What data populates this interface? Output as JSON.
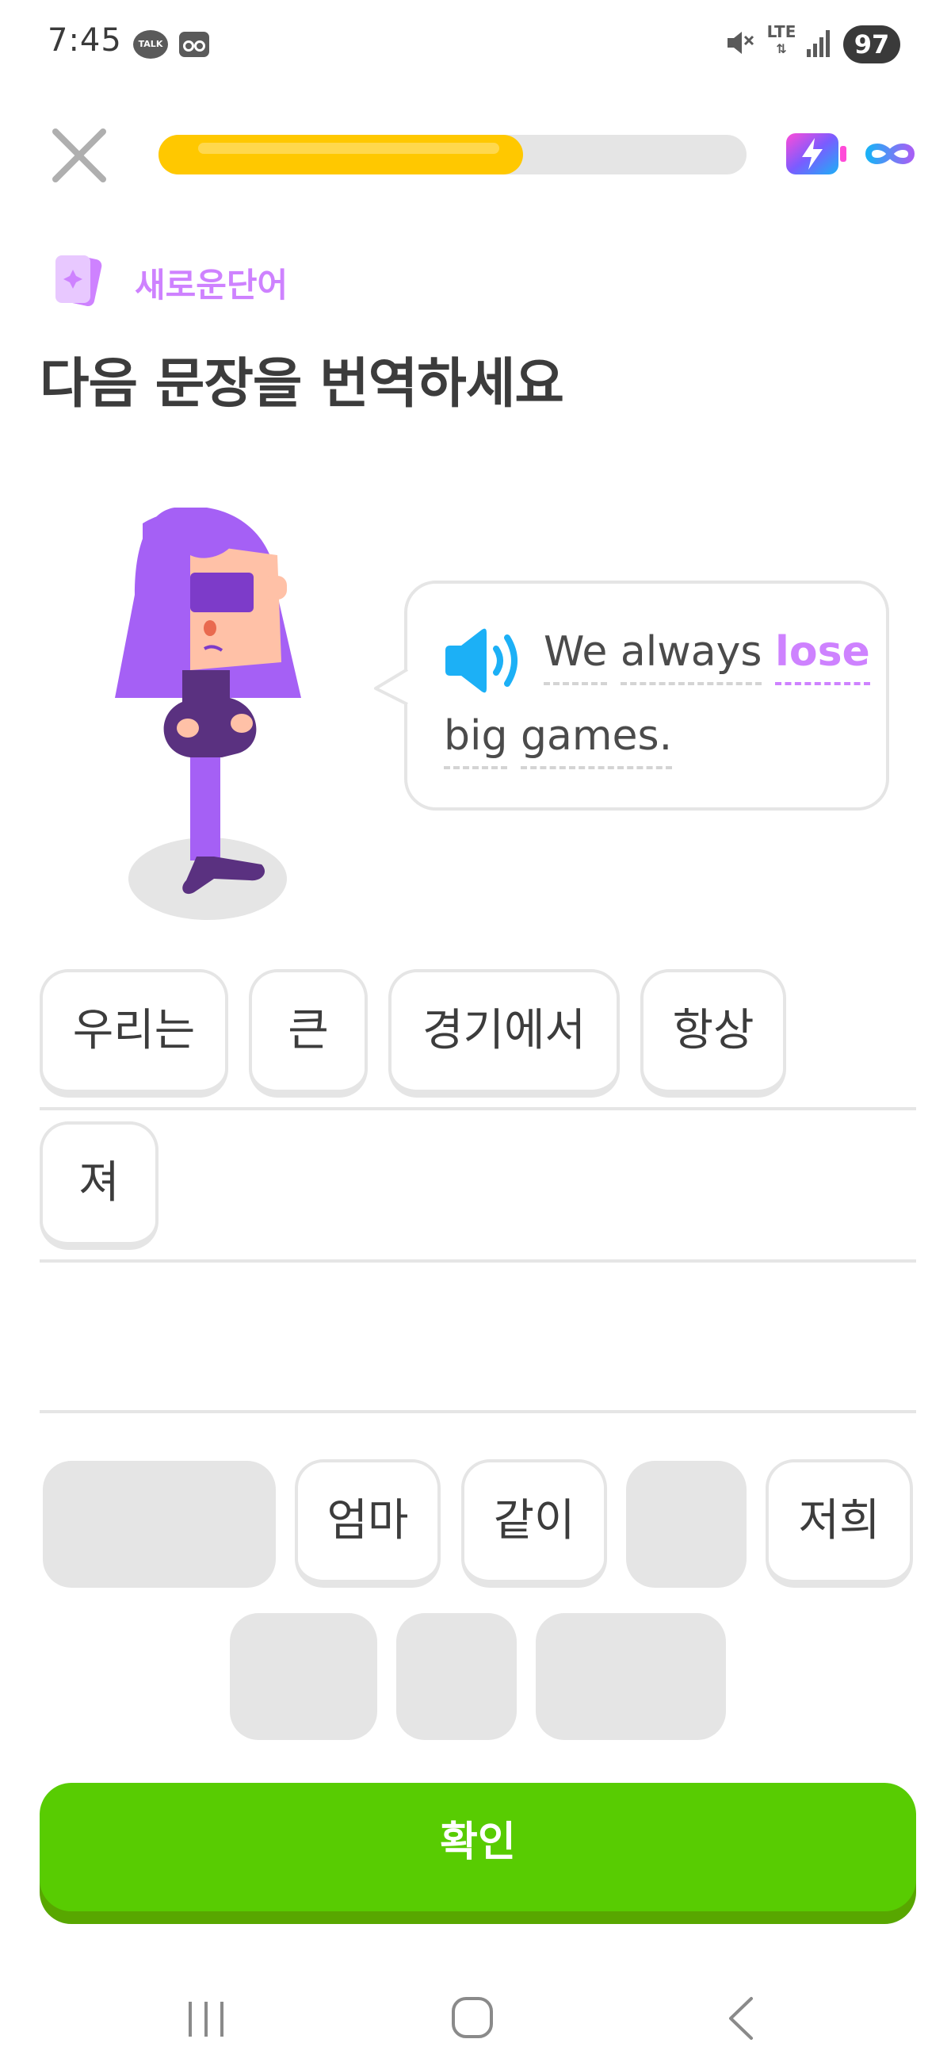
{
  "status_bar": {
    "time": "7:45",
    "talk_badge": "TALK",
    "network": "LTE",
    "battery": "97"
  },
  "header": {
    "progress_fraction": 0.62
  },
  "lesson": {
    "tag": "새로운단어",
    "instruction": "다음 문장을 번역하세요"
  },
  "prompt": {
    "line1": [
      {
        "text": "We"
      },
      {
        "text": "always"
      },
      {
        "text": "lose",
        "highlight": true
      }
    ],
    "line2": [
      {
        "text": "big"
      },
      {
        "text": "games."
      }
    ]
  },
  "answer_tiles": [
    "우리는",
    "큰",
    "경기에서",
    "항상",
    "져"
  ],
  "word_bank": {
    "row1": [
      "엄마",
      "같이",
      "저희"
    ]
  },
  "actions": {
    "check": "확인"
  },
  "colors": {
    "accent_green": "#58cc02",
    "progress_yellow": "#ffc800",
    "new_word_purple": "#ce82ff",
    "speaker_blue": "#1cb0f6"
  },
  "icons": [
    "close-icon",
    "energy-icon",
    "infinity-icon",
    "speaker-icon",
    "nav-recent-icon",
    "nav-home-icon",
    "nav-back-icon"
  ]
}
